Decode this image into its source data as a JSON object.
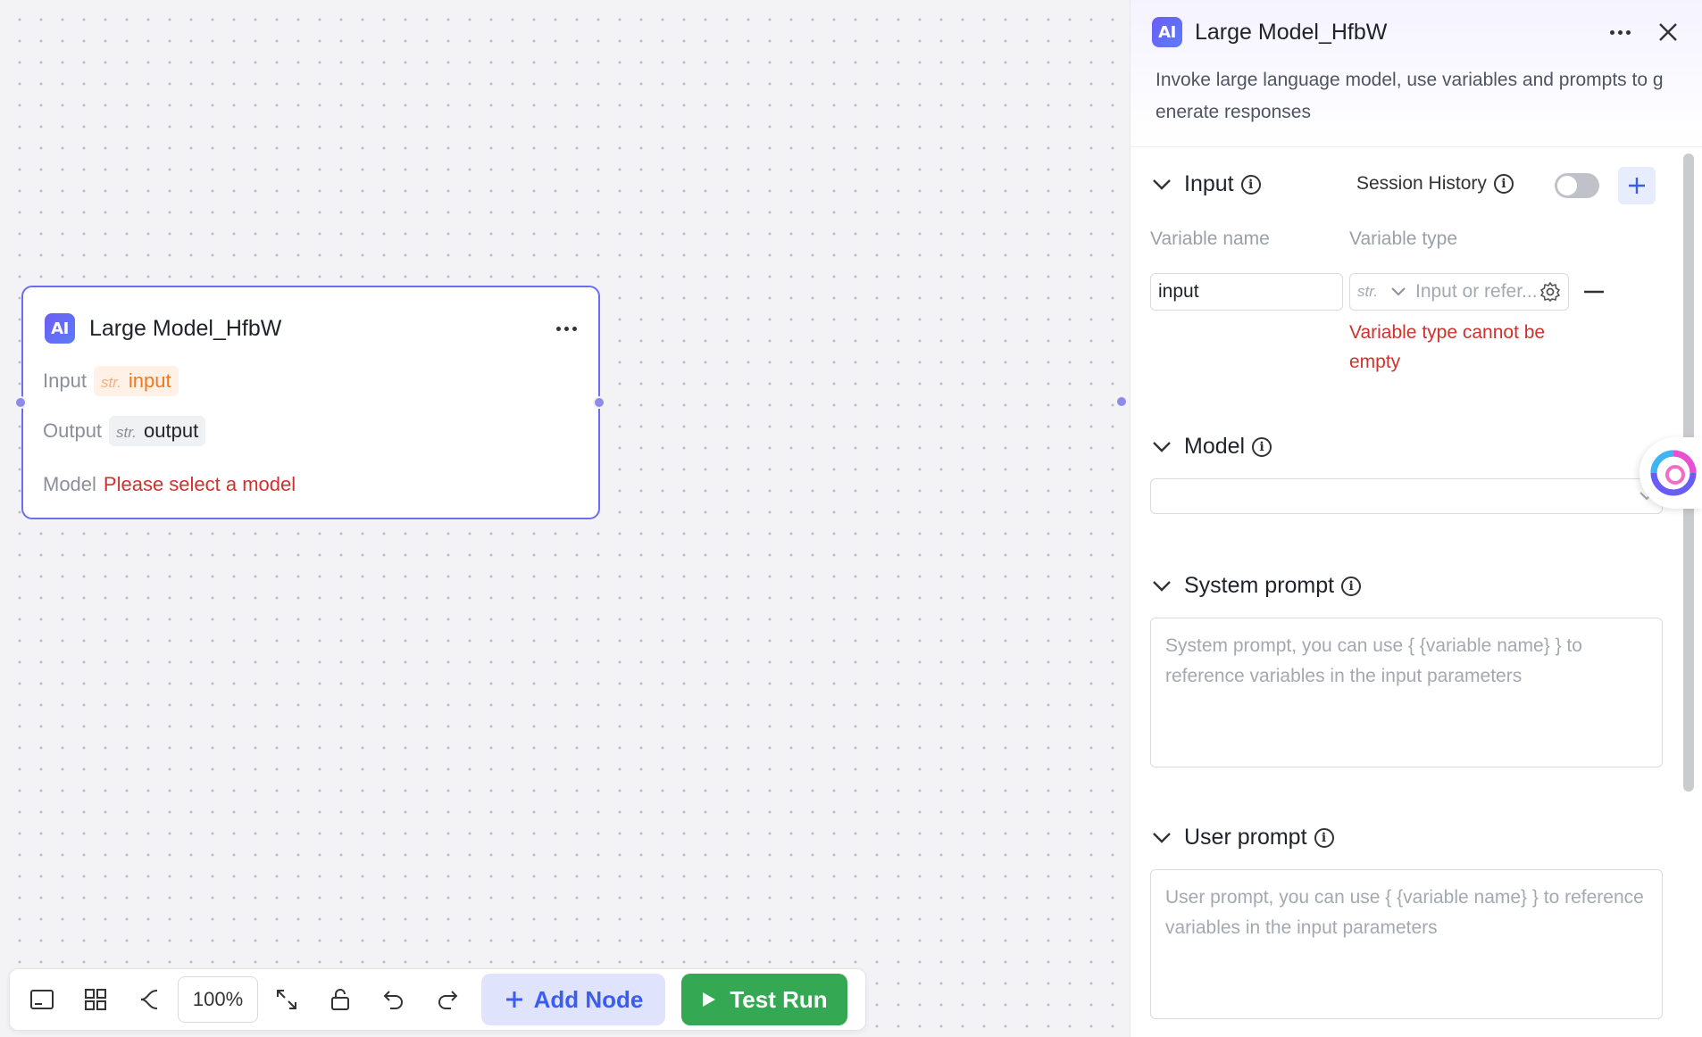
{
  "node": {
    "title": "Large Model_HfbW",
    "badge": "AI",
    "input_label": "Input",
    "input_type": "str.",
    "input_value": "input",
    "output_label": "Output",
    "output_type": "str.",
    "output_value": "output",
    "model_label": "Model",
    "model_value": "Please select a model"
  },
  "toolbar": {
    "zoom": "100%",
    "add_node": "Add Node",
    "test_run": "Test Run",
    "icons": [
      "minimap-icon",
      "layout-grid-icon",
      "connector-icon",
      "fit-view-icon",
      "lock-icon",
      "undo-icon",
      "redo-icon"
    ]
  },
  "panel": {
    "badge": "AI",
    "title": "Large Model_HfbW",
    "description": "Invoke large language model, use variables and prompts to generate responses",
    "input_section": {
      "title": "Input",
      "session_history_label": "Session History",
      "session_history_on": false,
      "col_variable_name": "Variable name",
      "col_variable_type": "Variable type",
      "variable_name_value": "input",
      "type_prefix": "str.",
      "type_placeholder": "Input or refer...",
      "error": "Variable type cannot be empty"
    },
    "model_section": {
      "title": "Model",
      "value": ""
    },
    "system_prompt": {
      "title": "System prompt",
      "placeholder": "System prompt, you can use { {variable name} } to reference variables in the input parameters"
    },
    "user_prompt": {
      "title": "User prompt",
      "placeholder": "User prompt, you can use { {variable name} } to reference variables in the input parameters"
    }
  },
  "colors": {
    "accent": "#3a5cf0",
    "node_border": "#6e6cf0",
    "error": "#d0312d",
    "run_green": "#34a853"
  }
}
